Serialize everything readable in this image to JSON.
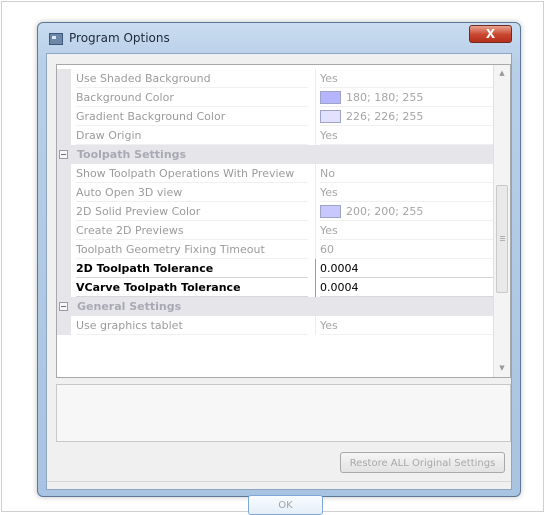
{
  "window": {
    "title": "Program Options",
    "close_label": "X"
  },
  "grid": {
    "rows": [
      {
        "type": "property",
        "name": "Use Shaded Background",
        "value": "Yes"
      },
      {
        "type": "property",
        "name": "Background Color",
        "value": "180; 180; 255",
        "swatch": "#b4b4ff"
      },
      {
        "type": "property",
        "name": "Gradient Background Color",
        "value": "226; 226; 255",
        "swatch": "#e2e2ff"
      },
      {
        "type": "property",
        "name": "Draw Origin",
        "value": "Yes"
      },
      {
        "type": "category",
        "name": "Toolpath Settings"
      },
      {
        "type": "property",
        "name": "Show Toolpath Operations With Preview",
        "value": "No"
      },
      {
        "type": "property",
        "name": "Auto Open 3D view",
        "value": "Yes"
      },
      {
        "type": "property",
        "name": "2D Solid Preview Color",
        "value": "200; 200; 255",
        "swatch": "#c8c8ff"
      },
      {
        "type": "property",
        "name": "Create 2D Previews",
        "value": "Yes"
      },
      {
        "type": "property",
        "name": "Toolpath Geometry Fixing Timeout",
        "value": "60"
      },
      {
        "type": "property",
        "name": "2D Toolpath Tolerance",
        "value": "0.0004",
        "emphasis": true
      },
      {
        "type": "property",
        "name": "VCarve Toolpath Tolerance",
        "value": "0.0004",
        "emphasis": true
      },
      {
        "type": "category",
        "name": "General Settings"
      },
      {
        "type": "property",
        "name": "Use graphics tablet",
        "value": "Yes"
      }
    ]
  },
  "buttons": {
    "restore_label": "Restore ALL Original Settings",
    "ok_label": "OK"
  }
}
